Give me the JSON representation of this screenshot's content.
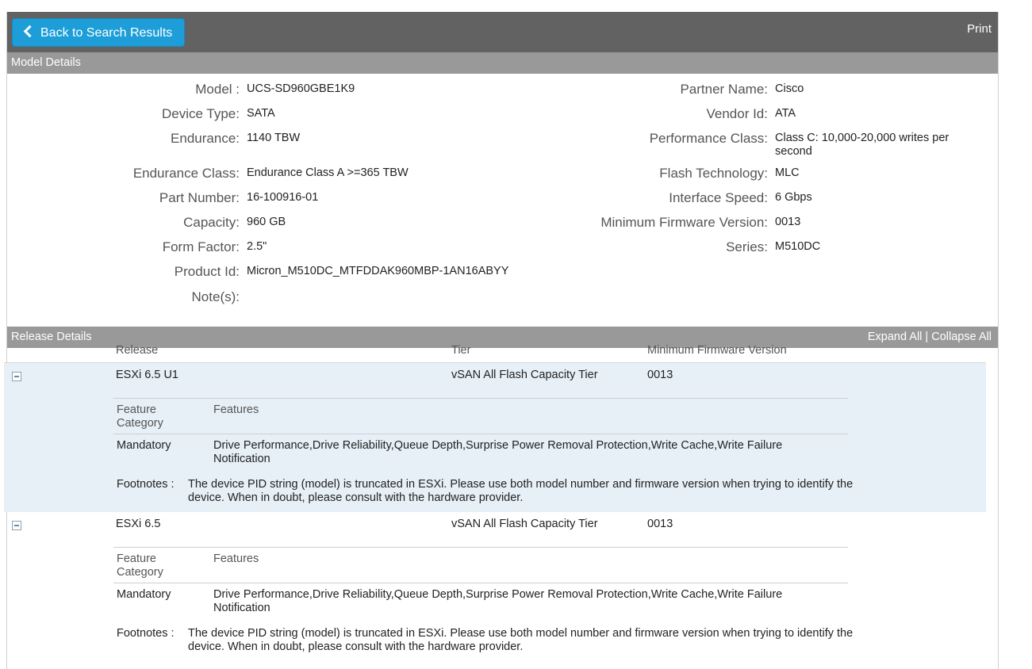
{
  "topbar": {
    "back_label": "Back to Search Results",
    "print_label": "Print"
  },
  "model_details": {
    "section_title": "Model Details",
    "left": [
      {
        "label": "Model :",
        "value": "UCS-SD960GBE1K9"
      },
      {
        "label": "Device Type:",
        "value": "SATA"
      },
      {
        "label": "Endurance:",
        "value": "1140 TBW"
      },
      {
        "label": "Endurance Class:",
        "value": "Endurance Class A >=365 TBW"
      },
      {
        "label": "Part Number:",
        "value": "16-100916-01"
      },
      {
        "label": "Capacity:",
        "value": "960 GB"
      },
      {
        "label": "Form Factor:",
        "value": "2.5\""
      },
      {
        "label": "Product Id:",
        "value": "Micron_M510DC_MTFDDAK960MBP-1AN16ABYY"
      },
      {
        "label": "Note(s):",
        "value": ""
      }
    ],
    "right": [
      {
        "label": "Partner Name:",
        "value": "Cisco"
      },
      {
        "label": "Vendor Id:",
        "value": "ATA"
      },
      {
        "label": "Performance Class:",
        "value": "Class C: 10,000-20,000 writes per second"
      },
      {
        "label": "Flash Technology:",
        "value": "MLC"
      },
      {
        "label": "Interface Speed:",
        "value": "6 Gbps"
      },
      {
        "label": "Minimum Firmware Version:",
        "value": "0013"
      },
      {
        "label": "Series:",
        "value": "M510DC"
      }
    ]
  },
  "release_details": {
    "section_title": "Release Details",
    "expand_all": "Expand All",
    "separator": "|",
    "collapse_all": "Collapse All",
    "columns": {
      "release": "Release",
      "tier": "Tier",
      "min_fw": "Minimum Firmware Version"
    },
    "feature_columns": {
      "category": "Feature Category",
      "features": "Features"
    },
    "footnote_label": "Footnotes  :",
    "releases": [
      {
        "release": "ESXi 6.5 U1",
        "tier": "vSAN All Flash Capacity Tier",
        "min_fw": "0013",
        "category": "Mandatory",
        "features": "Drive Performance,Drive Reliability,Queue Depth,Surprise Power Removal Protection,Write Cache,Write Failure Notification",
        "footnote": "The device PID string (model) is truncated in ESXi. Please use both model number and firmware version when trying to identify the device. When in doubt, please consult with the hardware provider."
      },
      {
        "release": "ESXi 6.5",
        "tier": "vSAN All Flash Capacity Tier",
        "min_fw": "0013",
        "category": "Mandatory",
        "features": "Drive Performance,Drive Reliability,Queue Depth,Surprise Power Removal Protection,Write Cache,Write Failure Notification",
        "footnote": "The device PID string (model) is truncated in ESXi. Please use both model number and firmware version when trying to identify the device. When in doubt, please consult with the hardware provider."
      }
    ]
  }
}
